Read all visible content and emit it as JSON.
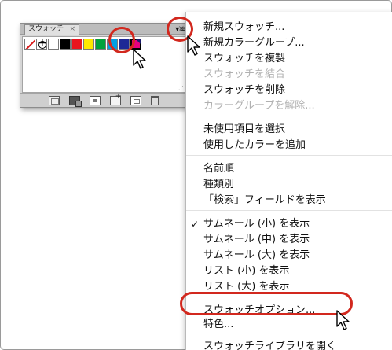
{
  "panel": {
    "tab_label": "スウォッチ",
    "tab_close": "×",
    "close_glyph": "×",
    "swatches": [
      {
        "name": "swatch-none",
        "kind": "none"
      },
      {
        "name": "swatch-registration",
        "kind": "registration"
      },
      {
        "name": "swatch-white",
        "color": "#ffffff"
      },
      {
        "name": "swatch-black",
        "color": "#000000"
      },
      {
        "name": "swatch-red",
        "color": "#e8141e"
      },
      {
        "name": "swatch-yellow",
        "color": "#ffe800"
      },
      {
        "name": "swatch-green",
        "color": "#00a23c"
      },
      {
        "name": "swatch-cyan",
        "color": "#00a0e6"
      },
      {
        "name": "swatch-blue",
        "color": "#1e2896"
      },
      {
        "name": "swatch-magenta",
        "color": "#e6007e"
      }
    ],
    "footer_icons": [
      "swatch-library-icon",
      "show-kind-icon",
      "swatch-options-icon",
      "new-color-group-icon",
      "new-swatch-icon",
      "delete-swatch-icon"
    ]
  },
  "flyout_button": {
    "glyph": "▾≡",
    "icon": "panel-menu-icon"
  },
  "menu": {
    "items": [
      {
        "label": "新規スウォッチ...",
        "enabled": true,
        "checked": false
      },
      {
        "label": "新規カラーグループ...",
        "enabled": true,
        "checked": false
      },
      {
        "label": "スウォッチを複製",
        "enabled": true,
        "checked": false
      },
      {
        "label": "スウォッチを結合",
        "enabled": false,
        "checked": false
      },
      {
        "label": "スウォッチを削除",
        "enabled": true,
        "checked": false
      },
      {
        "label": "カラーグループを解除...",
        "enabled": false,
        "checked": false
      },
      {
        "label": "未使用項目を選択",
        "enabled": true,
        "checked": false
      },
      {
        "label": "使用したカラーを追加",
        "enabled": true,
        "checked": false
      },
      {
        "label": "名前順",
        "enabled": true,
        "checked": false
      },
      {
        "label": "種類別",
        "enabled": true,
        "checked": false
      },
      {
        "label": "「検索」フィールドを表示",
        "enabled": true,
        "checked": false
      },
      {
        "label": "サムネール (小) を表示",
        "enabled": true,
        "checked": true
      },
      {
        "label": "サムネール (中) を表示",
        "enabled": true,
        "checked": false
      },
      {
        "label": "サムネール (大) を表示",
        "enabled": true,
        "checked": false
      },
      {
        "label": "リスト (小) を表示",
        "enabled": true,
        "checked": false
      },
      {
        "label": "リスト (大) を表示",
        "enabled": true,
        "checked": false
      },
      {
        "label": "スウォッチオプション...",
        "enabled": true,
        "checked": false
      },
      {
        "label": "特色...",
        "enabled": true,
        "checked": false
      },
      {
        "label": "スウォッチライブラリを開く",
        "enabled": true,
        "checked": false
      }
    ],
    "check_glyph": "✓"
  },
  "colors": {
    "annotation_red": "#d2281e",
    "disabled_text": "#b0b0b0",
    "panel_bg": "#d6d6d6"
  }
}
